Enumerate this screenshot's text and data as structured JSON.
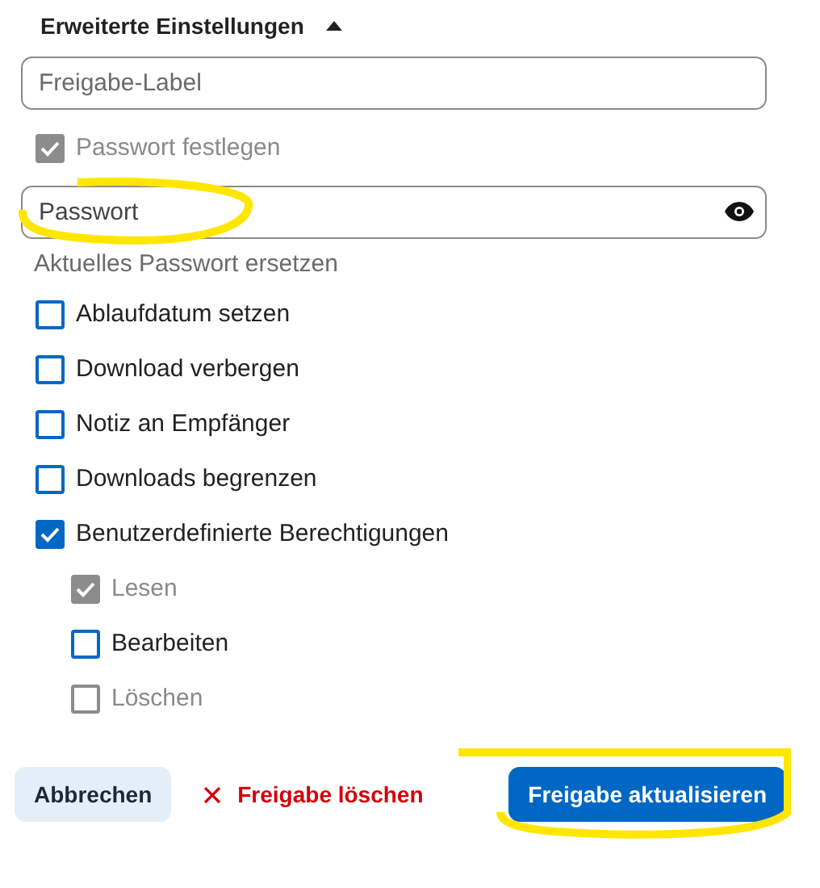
{
  "section": {
    "title": "Erweiterte Einstellungen",
    "expanded": true
  },
  "label_field": {
    "placeholder": "Freigabe-Label"
  },
  "password_option": {
    "label": "Passwort festlegen",
    "checked": true,
    "disabled": true
  },
  "password_field": {
    "placeholder": "Passwort"
  },
  "password_hint": "Aktuelles Passwort ersetzen",
  "options": [
    {
      "label": "Ablaufdatum setzen",
      "checked": false,
      "disabled": false
    },
    {
      "label": "Download verbergen",
      "checked": false,
      "disabled": false
    },
    {
      "label": "Notiz an Empfänger",
      "checked": false,
      "disabled": false
    },
    {
      "label": "Downloads begrenzen",
      "checked": false,
      "disabled": false
    },
    {
      "label": "Benutzerdefinierte Berechtigungen",
      "checked": true,
      "disabled": false,
      "children": [
        {
          "label": "Lesen",
          "checked": true,
          "disabled": true
        },
        {
          "label": "Bearbeiten",
          "checked": false,
          "disabled": false
        },
        {
          "label": "Löschen",
          "checked": false,
          "disabled": true
        }
      ]
    }
  ],
  "buttons": [
    {
      "kind": "secondary",
      "label": "Abbrechen"
    },
    {
      "kind": "danger",
      "label": "Freigabe löschen"
    },
    {
      "kind": "primary",
      "label": "Freigabe aktualisieren"
    }
  ]
}
